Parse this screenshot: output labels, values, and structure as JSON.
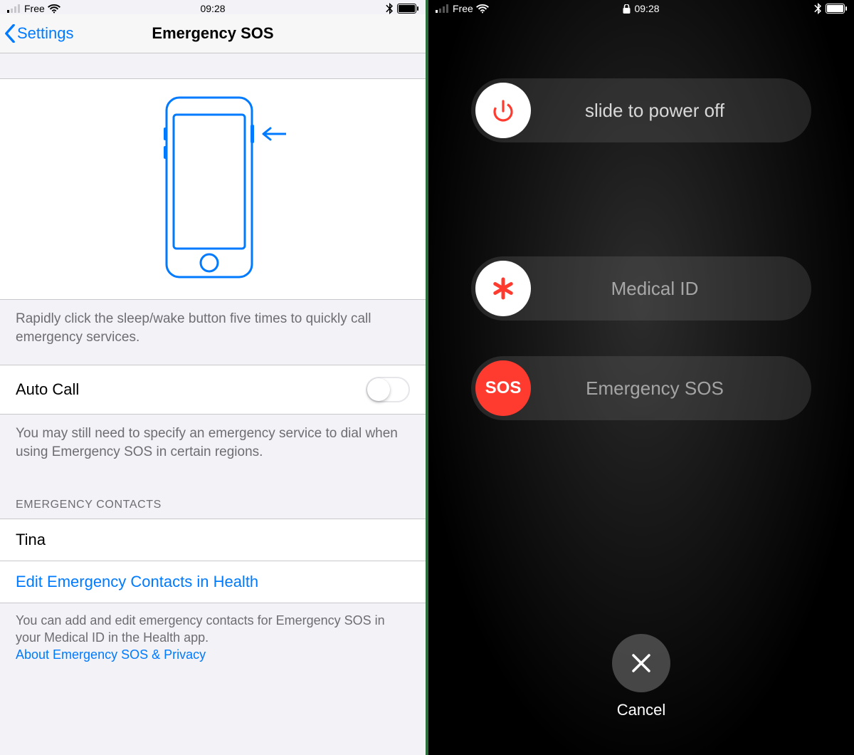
{
  "left": {
    "status": {
      "carrier": "Free",
      "time": "09:28"
    },
    "nav": {
      "back": "Settings",
      "title": "Emergency SOS"
    },
    "instruction": "Rapidly click the sleep/wake button five times to quickly call emergency services.",
    "autocall": {
      "label": "Auto Call",
      "on": false
    },
    "autocall_desc": "You may still need to specify an emergency service to dial when using Emergency SOS in certain regions.",
    "contacts_header": "EMERGENCY CONTACTS",
    "contacts": [
      {
        "name": "Tina"
      }
    ],
    "edit_link": "Edit Emergency Contacts in Health",
    "footer_text": "You can add and edit emergency contacts for Emergency SOS in your Medical ID in the Health app.",
    "footer_link": "About Emergency SOS & Privacy"
  },
  "right": {
    "status": {
      "carrier": "Free",
      "time": "09:28"
    },
    "sliders": {
      "power": "slide to power off",
      "medical": "Medical ID",
      "sos_knob": "SOS",
      "sos": "Emergency SOS"
    },
    "cancel": "Cancel"
  }
}
